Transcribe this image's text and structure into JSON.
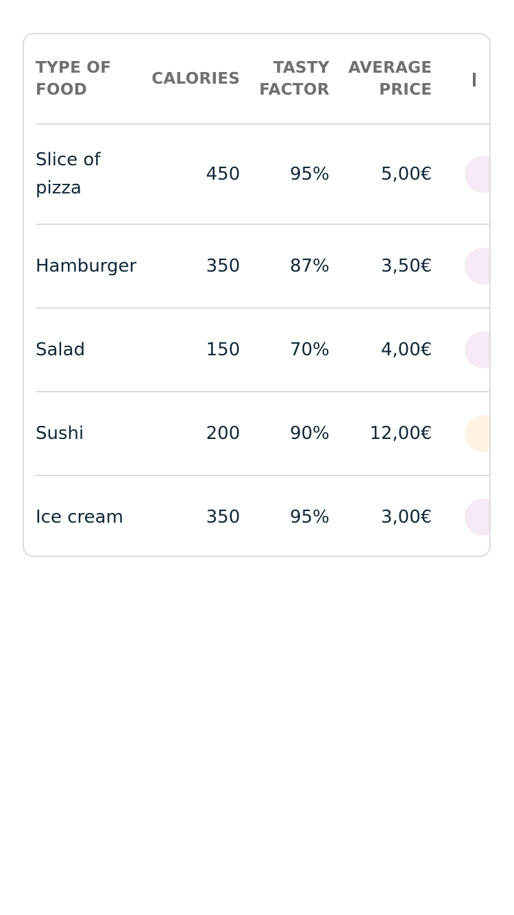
{
  "table": {
    "headers": {
      "type_of_food": "TYPE OF FOOD",
      "calories": "CALORIES",
      "tasty_factor": "TASTY FACTOR",
      "average_price": "AVERAGE PRICE"
    },
    "rows": [
      {
        "name": "Slice of pizza",
        "calories": "450",
        "tasty": "95%",
        "price": "5,00€",
        "chip_color": "#f5eaf5"
      },
      {
        "name": "Hamburger",
        "calories": "350",
        "tasty": "87%",
        "price": "3,50€",
        "chip_color": "#f5eaf5"
      },
      {
        "name": "Salad",
        "calories": "150",
        "tasty": "70%",
        "price": "4,00€",
        "chip_color": "#f5eaf5"
      },
      {
        "name": "Sushi",
        "calories": "200",
        "tasty": "90%",
        "price": "12,00€",
        "chip_color": "#fff3e3"
      },
      {
        "name": "Ice cream",
        "calories": "350",
        "tasty": "95%",
        "price": "3,00€",
        "chip_color": "#f5eaf5"
      }
    ]
  }
}
